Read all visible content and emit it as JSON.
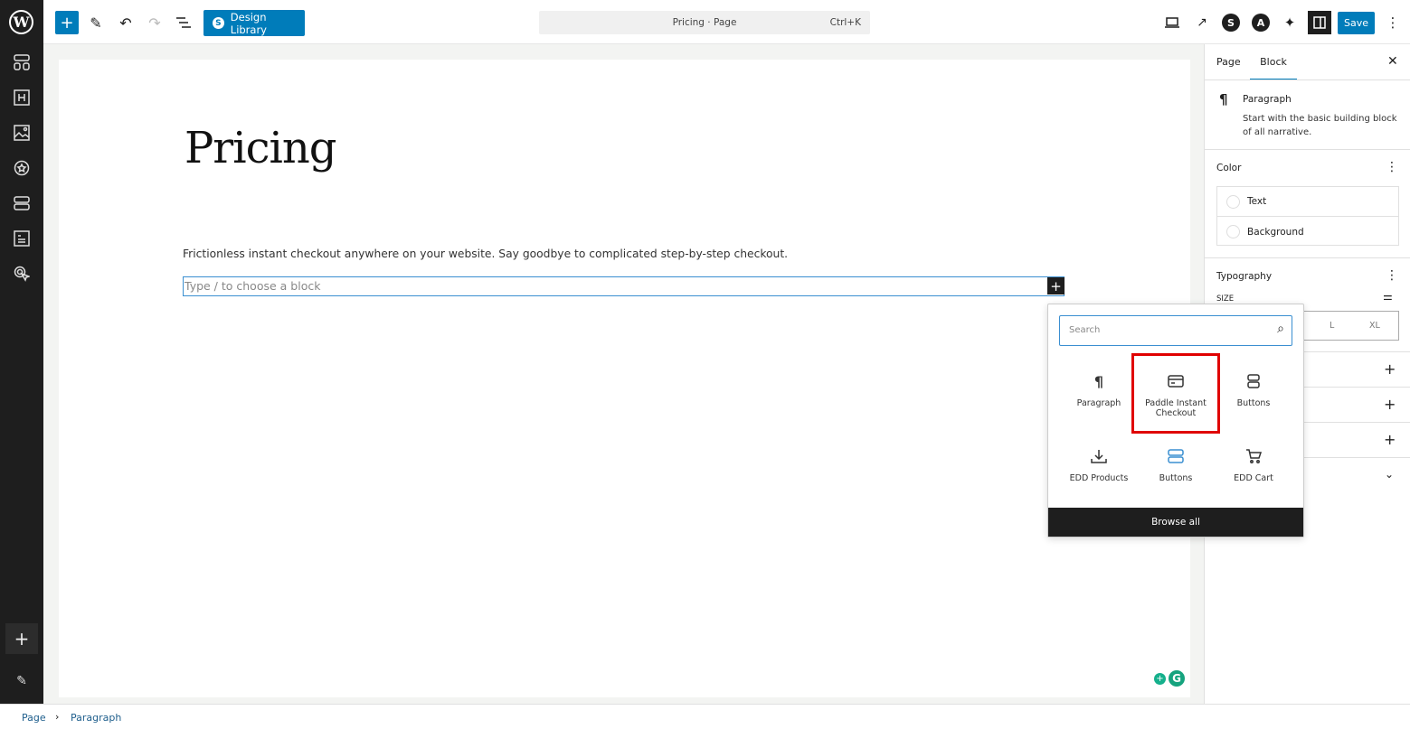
{
  "topbar": {
    "design_library": "Design Library",
    "command": "Pricing · Page",
    "shortcut": "Ctrl+K",
    "save": "Save"
  },
  "sidebar": {
    "icons": [
      "patterns-icon",
      "heading-icon",
      "image-icon",
      "badge-icon",
      "buttons-icon",
      "post-icon",
      "cursor-icon"
    ]
  },
  "editor": {
    "title": "Pricing",
    "paragraph": "Frictionless instant checkout anywhere on your website. Say goodbye to complicated step-by-step checkout.",
    "placeholder": "Type / to choose a block"
  },
  "inserter": {
    "search_placeholder": "Search",
    "items": [
      {
        "label": "Paragraph",
        "icon": "paragraph-icon"
      },
      {
        "label": "Paddle Instant Checkout",
        "icon": "card-icon",
        "highlighted": true
      },
      {
        "label": "Buttons",
        "icon": "buttons-icon"
      },
      {
        "label": "EDD Products",
        "icon": "download-icon"
      },
      {
        "label": "Buttons",
        "icon": "buttons-icon",
        "accent": "#3a8fd1"
      },
      {
        "label": "EDD Cart",
        "icon": "cart-icon"
      }
    ],
    "browse_all": "Browse all",
    "highlight_color": "#e00000"
  },
  "panel": {
    "tabs": [
      "Page",
      "Block"
    ],
    "active_tab": "Block",
    "block_name": "Paragraph",
    "block_desc": "Start with the basic building block of all narrative.",
    "color_label": "Color",
    "color_items": [
      "Text",
      "Background"
    ],
    "typography_label": "Typography",
    "size_label": "SIZE",
    "sizes": [
      "L",
      "XL"
    ]
  },
  "breadcrumb": [
    "Page",
    "Paragraph"
  ],
  "accent": "#007cba"
}
